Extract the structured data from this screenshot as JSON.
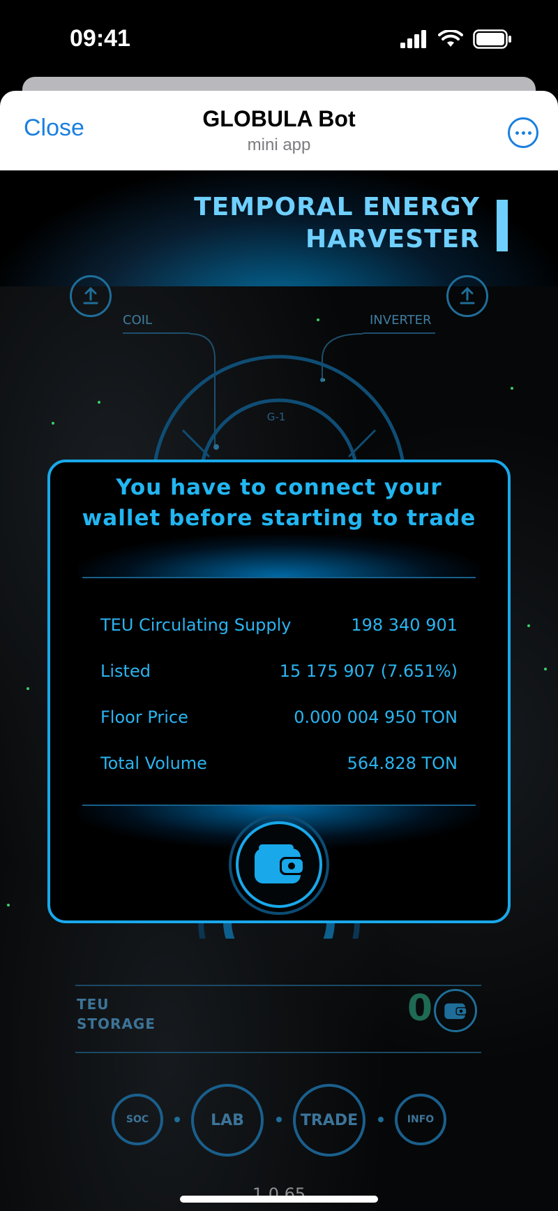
{
  "status_bar": {
    "time": "09:41"
  },
  "header": {
    "close_label": "Close",
    "title": "GLOBULA Bot",
    "subtitle": "mini app"
  },
  "banner": {
    "line1": "TEMPORAL ENERGY",
    "line2": "HARVESTER"
  },
  "machine": {
    "coil_label": "COIL",
    "inverter_label": "INVERTER",
    "gauge_label": "G-1"
  },
  "modal": {
    "title_line1": "You have to connect your",
    "title_line2": "wallet before starting to trade",
    "stats": [
      {
        "label": "TEU Circulating Supply",
        "value": "198 340 901"
      },
      {
        "label": "Listed",
        "value": "15 175 907 (7.651%)"
      },
      {
        "label": "Floor Price",
        "value": "0.000 004 950 TON"
      },
      {
        "label": "Total Volume",
        "value": "564.828 TON"
      }
    ]
  },
  "storage": {
    "label_line1": "TEU",
    "label_line2": "STORAGE",
    "value": "0"
  },
  "nav": {
    "soc": "SOC",
    "lab": "LAB",
    "trade": "TRADE",
    "info": "INFO"
  },
  "version": "1.0.65",
  "colors": {
    "accent": "#19a8ea",
    "ios_blue": "#1a7fe0",
    "storage_value": "#1f6a54"
  }
}
